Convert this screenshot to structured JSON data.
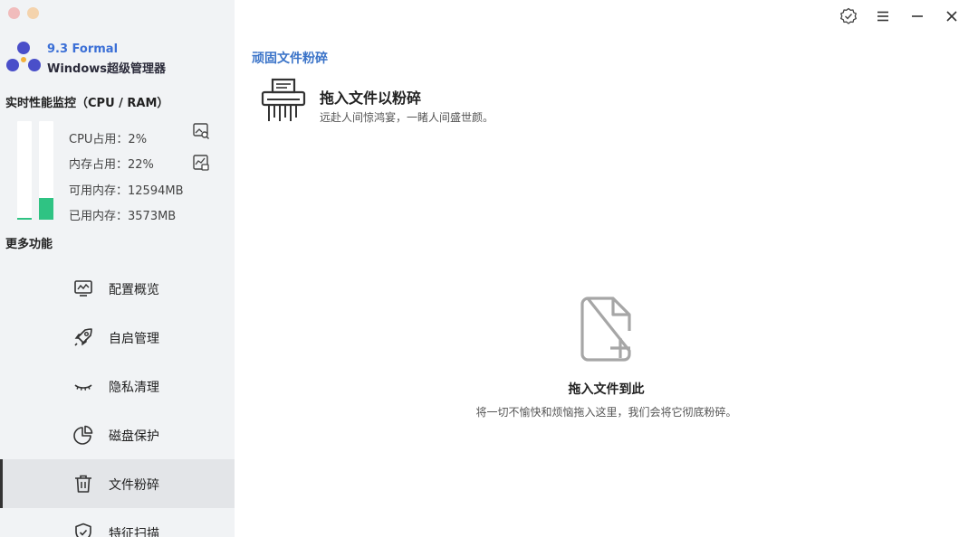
{
  "app": {
    "version": "9.3 Formal",
    "name": "Windows超级管理器"
  },
  "monitor": {
    "title": "实时性能监控（CPU / RAM）",
    "cpu_usage_label": "CPU占用：2%",
    "cpu_usage_percent": 2,
    "memory_usage_label": "内存占用：22%",
    "memory_usage_percent": 22,
    "available_memory_label": "可用内存：12594MB",
    "used_memory_label": "已用内存：3573MB",
    "bar_color": "#2fc383"
  },
  "more": {
    "title": "更多功能"
  },
  "nav": {
    "items": [
      {
        "label": "配置概览",
        "icon": "monitor-icon"
      },
      {
        "label": "自启管理",
        "icon": "rocket-icon"
      },
      {
        "label": "隐私清理",
        "icon": "closed-eye-icon"
      },
      {
        "label": "磁盘保护",
        "icon": "pie-chart-icon"
      },
      {
        "label": "文件粉碎",
        "icon": "trash-icon",
        "active": true
      },
      {
        "label": "特征扫描",
        "icon": "shield-check-icon"
      }
    ]
  },
  "window": {
    "controls": [
      "verified-badge-icon",
      "menu-icon",
      "minimize-icon",
      "close-icon"
    ]
  },
  "main": {
    "section_title": "顽固文件粉碎",
    "heading": "拖入文件以粉碎",
    "subheading": "远赴人间惊鸿宴，一睹人间盛世颜。",
    "drop_title": "拖入文件到此",
    "drop_description": "将一切不愉快和烦恼拖入这里，我们会将它彻底粉碎。"
  },
  "colors": {
    "accent": "#3a73c8",
    "sidebar_bg": "#f1f3f5",
    "active_bg": "#e3e5e8"
  }
}
